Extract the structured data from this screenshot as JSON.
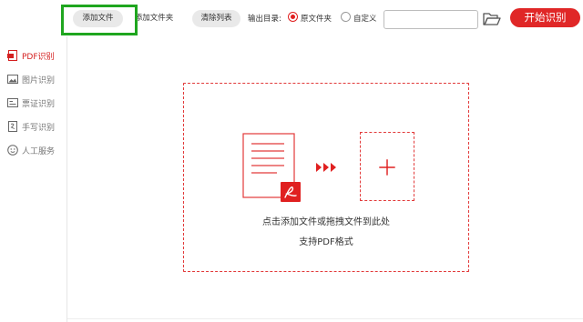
{
  "toolbar": {
    "add_file_label": "添加文件",
    "add_folder_label": "添加文件夹",
    "clear_list_label": "清除列表",
    "output_dir_label": "输出目录:",
    "radio_original_label": "原文件夹",
    "radio_custom_label": "自定义",
    "selected_output": "原文件夹",
    "path_value": "",
    "start_label": "开始识别"
  },
  "sidebar": {
    "items": [
      {
        "label": "PDF识别",
        "icon": "pdf-icon",
        "active": true
      },
      {
        "label": "图片识别",
        "icon": "image-icon",
        "active": false
      },
      {
        "label": "票证识别",
        "icon": "ticket-icon",
        "active": false
      },
      {
        "label": "手写识别",
        "icon": "handwriting-icon",
        "active": false
      },
      {
        "label": "人工服务",
        "icon": "service-icon",
        "active": false
      }
    ]
  },
  "dropzone": {
    "hint_primary": "点击添加文件或拖拽文件到此处",
    "hint_secondary": "支持PDF格式"
  },
  "colors": {
    "accent": "#e02727",
    "highlight": "#1fa61f",
    "button_bg": "#e9e9e9"
  }
}
